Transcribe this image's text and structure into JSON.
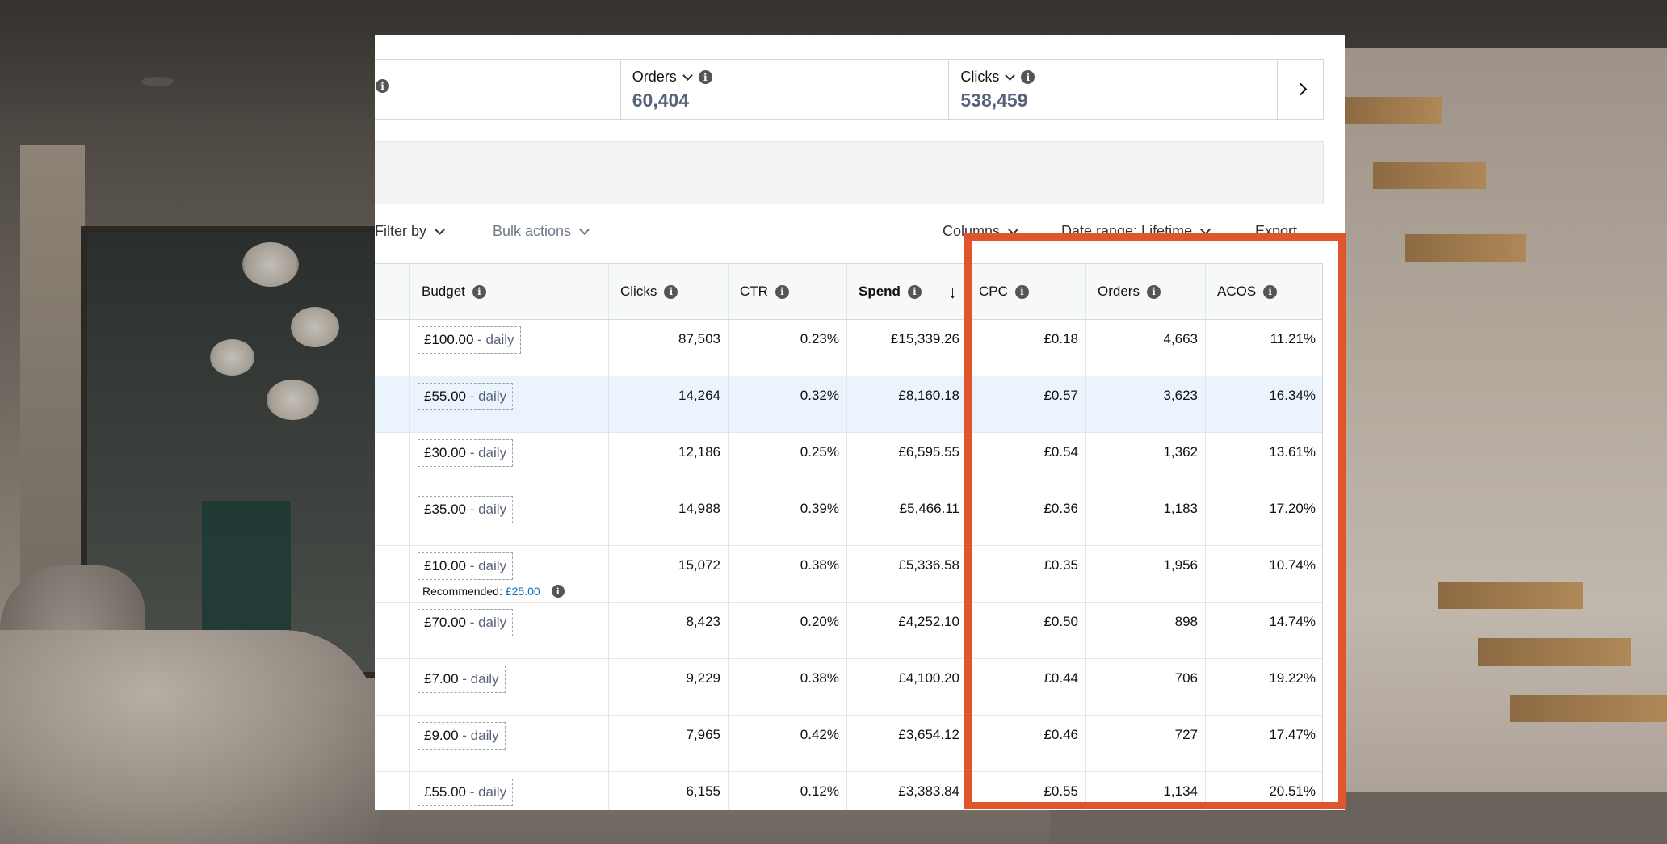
{
  "metrics": [
    {
      "label": "Orders",
      "value": "60,404"
    },
    {
      "label": "Clicks",
      "value": "538,459"
    }
  ],
  "toolbar": {
    "filter_label": "Filter by",
    "bulk_label": "Bulk actions",
    "columns_label": "Columns",
    "date_label": "Date range: Lifetime",
    "export_label": "Export"
  },
  "columns": {
    "budget": "Budget",
    "clicks": "Clicks",
    "ctr": "CTR",
    "spend": "Spend",
    "cpc": "CPC",
    "orders": "Orders",
    "acos": "ACOS"
  },
  "budget_suffix": " - daily",
  "rows": [
    {
      "budget": "£100.00",
      "clicks": "87,503",
      "ctr": "0.23%",
      "spend": "£15,339.26",
      "cpc": "£0.18",
      "orders": "4,663",
      "acos": "11.21%"
    },
    {
      "budget": "£55.00",
      "clicks": "14,264",
      "ctr": "0.32%",
      "spend": "£8,160.18",
      "cpc": "£0.57",
      "orders": "3,623",
      "acos": "16.34%"
    },
    {
      "budget": "£30.00",
      "clicks": "12,186",
      "ctr": "0.25%",
      "spend": "£6,595.55",
      "cpc": "£0.54",
      "orders": "1,362",
      "acos": "13.61%"
    },
    {
      "budget": "£35.00",
      "clicks": "14,988",
      "ctr": "0.39%",
      "spend": "£5,466.11",
      "cpc": "£0.36",
      "orders": "1,183",
      "acos": "17.20%"
    },
    {
      "budget": "£10.00",
      "clicks": "15,072",
      "ctr": "0.38%",
      "spend": "£5,336.58",
      "cpc": "£0.35",
      "orders": "1,956",
      "acos": "10.74%",
      "recommended_label": "Recommended:",
      "recommended_value": "£25.00"
    },
    {
      "budget": "£70.00",
      "clicks": "8,423",
      "ctr": "0.20%",
      "spend": "£4,252.10",
      "cpc": "£0.50",
      "orders": "898",
      "acos": "14.74%"
    },
    {
      "budget": "£7.00",
      "clicks": "9,229",
      "ctr": "0.38%",
      "spend": "£4,100.20",
      "cpc": "£0.44",
      "orders": "706",
      "acos": "19.22%"
    },
    {
      "budget": "£9.00",
      "clicks": "7,965",
      "ctr": "0.42%",
      "spend": "£3,654.12",
      "cpc": "£0.46",
      "orders": "727",
      "acos": "17.47%"
    },
    {
      "budget": "£55.00",
      "clicks": "6,155",
      "ctr": "0.12%",
      "spend": "£3,383.84",
      "cpc": "£0.55",
      "orders": "1,134",
      "acos": "20.51%"
    }
  ],
  "icons": {
    "info": "info-icon",
    "chevron": "chevron-down-icon",
    "next": "chevron-right-icon",
    "sort": "sort-descending-icon"
  },
  "colors": {
    "highlight": "#e0562c",
    "metric_value": "#56627a",
    "link": "#0a6ebd",
    "selected_row": "#ebf4fc"
  }
}
